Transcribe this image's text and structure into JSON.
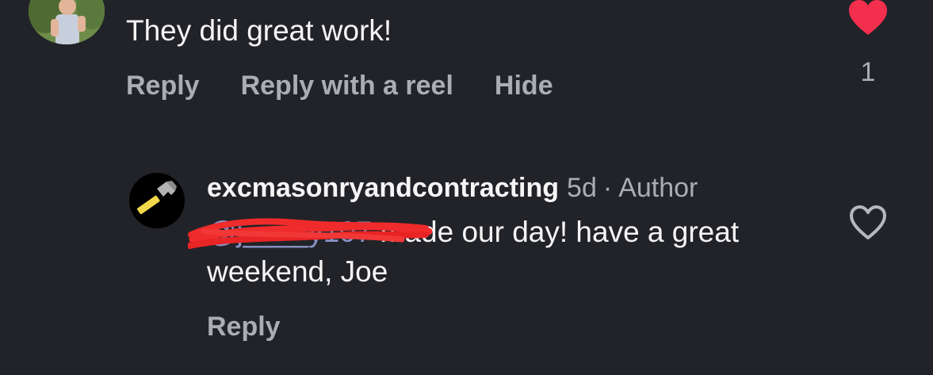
{
  "top_comment": {
    "text": "They did great work!",
    "actions": {
      "reply": "Reply",
      "reply_with_reel": "Reply with a reel",
      "hide": "Hide"
    },
    "like_count": "1",
    "liked": true
  },
  "reply_comment": {
    "username": "excmasonryandcontracting",
    "timestamp": "5d",
    "separator": "·",
    "author_label": "Author",
    "mention_text": "@j____y107",
    "body_text": " made our day!  have a great weekend, Joe",
    "actions": {
      "reply": "Reply"
    },
    "liked": false
  },
  "colors": {
    "background": "#222328",
    "primary_text": "#f5f5f6",
    "secondary_text": "#a9adb5",
    "heart_red": "#f32f4d",
    "mention": "#8a92c8",
    "redaction": "#ef2b2b"
  },
  "icons": {
    "top_like": "heart-filled-icon",
    "reply_like": "heart-outline-icon",
    "brand_avatar": "hammer-icon"
  }
}
